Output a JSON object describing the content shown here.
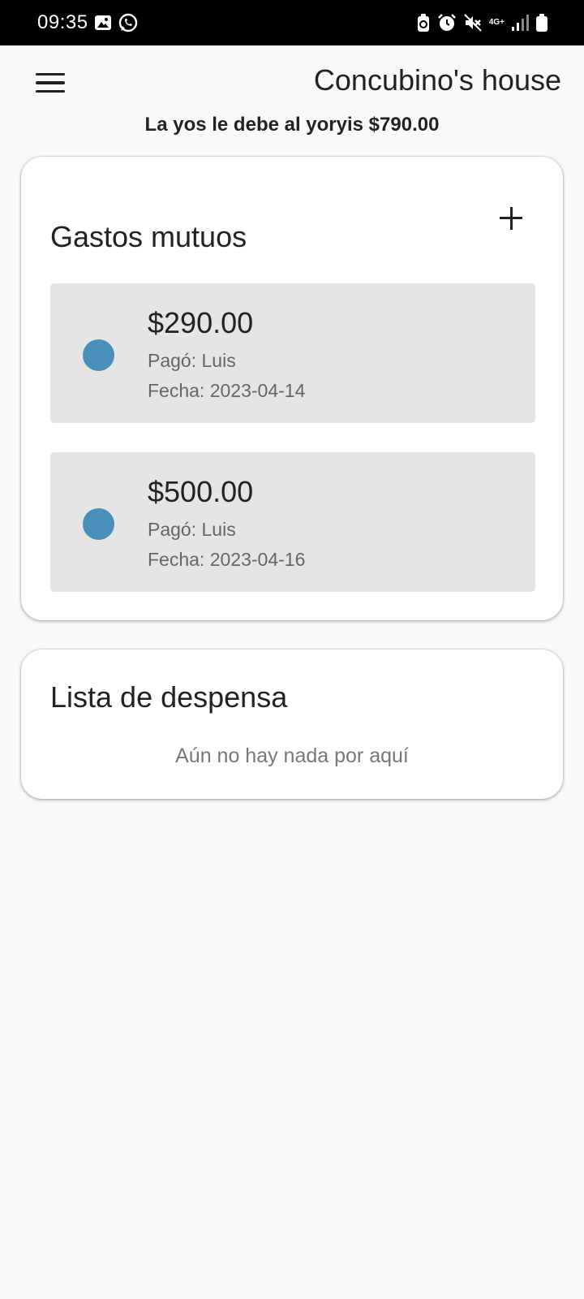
{
  "status_bar": {
    "time": "09:35",
    "left_icons": [
      "image-icon",
      "whatsapp-icon"
    ],
    "right_icons": [
      "battery-saver-icon",
      "alarm-icon",
      "mute-icon",
      "network-4g-icon",
      "signal-icon",
      "battery-icon"
    ],
    "network_label": "4G+"
  },
  "app_bar": {
    "menu_icon": "hamburger-menu-icon",
    "title": "Concubino's house"
  },
  "summary": "La yos le debe al yoryis $790.00",
  "expenses_card": {
    "title": "Gastos mutuos",
    "add_icon": "plus-icon",
    "items": [
      {
        "amount": "$290.00",
        "payer": "Pagó: Luis",
        "date": "Fecha: 2023-04-14",
        "dot_color": "#4a8fba"
      },
      {
        "amount": "$500.00",
        "payer": "Pagó: Luis",
        "date": "Fecha: 2023-04-16",
        "dot_color": "#4a8fba"
      }
    ]
  },
  "pantry_card": {
    "title": "Lista de despensa",
    "empty_message": "Aún no hay nada por aquí"
  },
  "colors": {
    "background": "#f9f9f9",
    "card": "#ffffff",
    "item_background": "#e5e5e5",
    "accent_dot": "#4a8fba",
    "status_bar": "#000000"
  }
}
